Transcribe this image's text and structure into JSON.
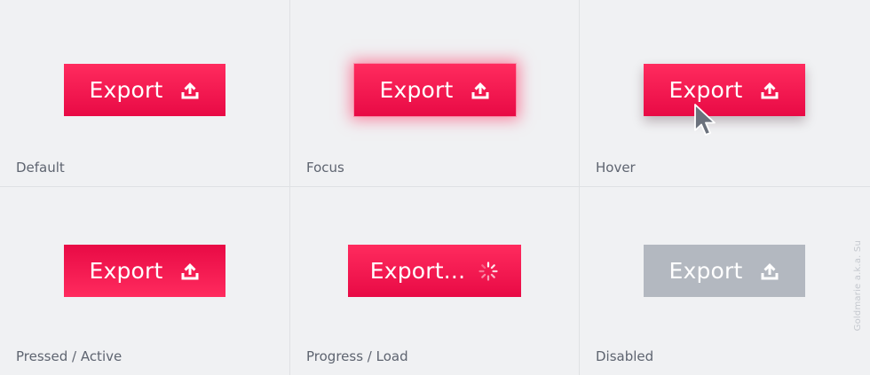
{
  "states": [
    {
      "button_label": "Export",
      "caption": "Default",
      "icon": "upload-icon"
    },
    {
      "button_label": "Export",
      "caption": "Focus",
      "icon": "upload-icon"
    },
    {
      "button_label": "Export",
      "caption": "Hover",
      "icon": "upload-icon"
    },
    {
      "button_label": "Export",
      "caption": "Pressed / Active",
      "icon": "upload-icon"
    },
    {
      "button_label": "Export...",
      "caption": "Progress / Load",
      "icon": "spinner-icon"
    },
    {
      "button_label": "Export",
      "caption": "Disabled",
      "icon": "upload-icon"
    }
  ],
  "watermark": "Goldmarie a.k.a. Su",
  "colors": {
    "accent": "#f5184f",
    "accent_light": "#ff2b5e",
    "accent_dark": "#e80a45",
    "disabled": "#b3b8c0",
    "background": "#f0f1f3",
    "caption_text": "#5e6470",
    "divider": "#dfe1e4"
  }
}
